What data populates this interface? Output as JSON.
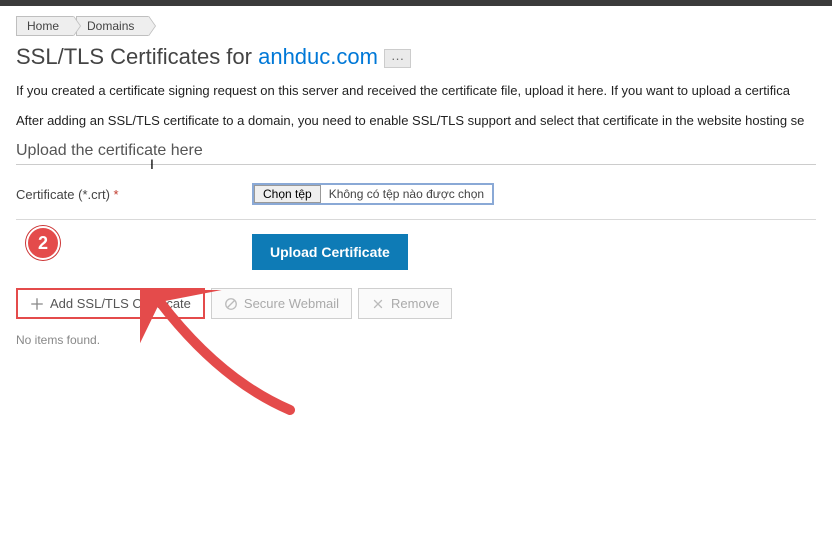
{
  "breadcrumb": {
    "home": "Home",
    "domains": "Domains"
  },
  "heading": {
    "prefix": "SSL/TLS Certificates for ",
    "domain": "anhduc.com",
    "more": "···"
  },
  "intro": {
    "p1": "If you created a certificate signing request on this server and received the certificate file, upload it here. If you want to upload a certifica",
    "p2": "After adding an SSL/TLS certificate to a domain, you need to enable SSL/TLS support and select that certificate in the website hosting se"
  },
  "section_title": "Upload the certificate here",
  "form": {
    "cert_label": "Certificate (*.crt)",
    "required": "*",
    "choose": "Chọn tệp",
    "none": "Không có tệp nào được chọn"
  },
  "step_badge": "2",
  "upload_btn": "Upload Certificate",
  "toolbar": {
    "add": "Add SSL/TLS Certificate",
    "secure": "Secure Webmail",
    "remove": "Remove"
  },
  "empty": "No items found."
}
